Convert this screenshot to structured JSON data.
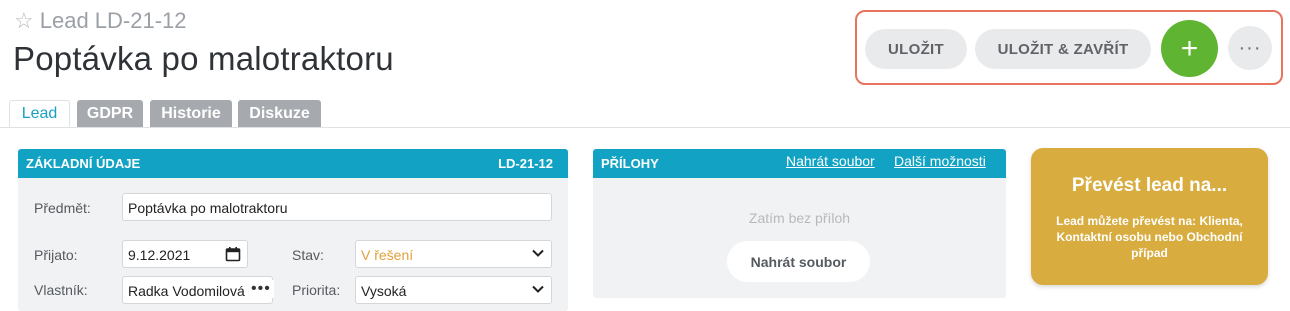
{
  "header": {
    "record_type": "Lead LD-21-12",
    "title": "Poptávka po malotraktoru"
  },
  "actions": {
    "save_label": "ULOŽIT",
    "save_close_label": "ULOŽIT & ZAVŘÍT",
    "add_label": "+",
    "more_label": "···"
  },
  "tabs": [
    {
      "label": "Lead"
    },
    {
      "label": "GDPR"
    },
    {
      "label": "Historie"
    },
    {
      "label": "Diskuze"
    }
  ],
  "basic": {
    "header": "ZÁKLADNÍ ÚDAJE",
    "id": "LD-21-12",
    "subject_label": "Předmět:",
    "subject_value": "Poptávka po malotraktoru",
    "received_label": "Přijato:",
    "received_value": "9.12.2021",
    "status_label": "Stav:",
    "status_value": "V řešení",
    "owner_label": "Vlastník:",
    "owner_value": "Radka Vodomilová",
    "priority_label": "Priorita:",
    "priority_value": "Vysoká"
  },
  "attachments": {
    "header": "PŘÍLOHY",
    "upload_link": "Nahrát soubor",
    "more_link": "Další možnosti",
    "empty_text": "Zatím bez příloh",
    "upload_button": "Nahrát soubor"
  },
  "convert": {
    "title": "Převést lead na...",
    "description": "Lead můžete převést na: Klienta, Kontaktní osobu nebo Obchodní případ"
  },
  "colors": {
    "accent": "#12a3c4",
    "add_button": "#5fb531",
    "convert_card": "#d8ac3f",
    "highlight_border": "#e8735f",
    "status_text": "#e0a13a"
  },
  "icons": {
    "favorite": "star-outline-icon",
    "add": "plus-icon",
    "more": "more-horizontal-icon",
    "date": "calendar-icon",
    "dropdown": "chevron-down-icon"
  }
}
